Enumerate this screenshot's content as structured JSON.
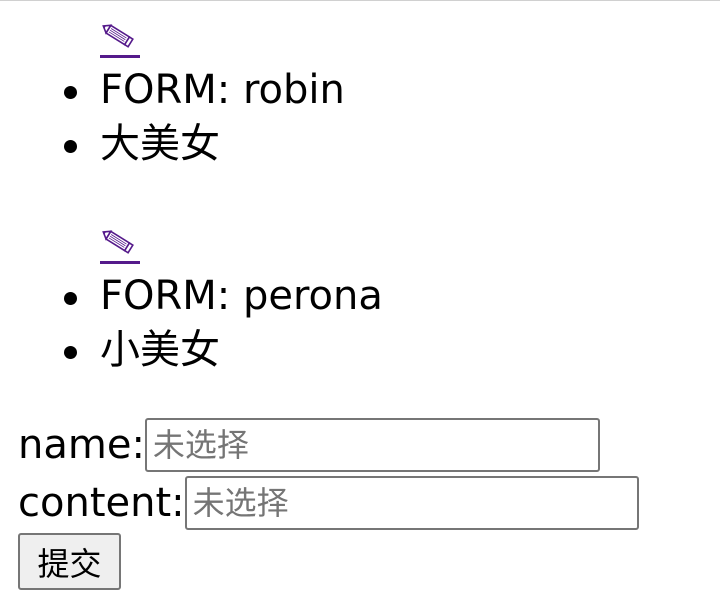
{
  "entries": [
    {
      "edit_icon": "pencil-icon",
      "form_line": "FORM: robin",
      "content_line": "大美女"
    },
    {
      "edit_icon": "pencil-icon",
      "form_line": "FORM: perona",
      "content_line": "小美女"
    }
  ],
  "form": {
    "name_label": "name:",
    "name_placeholder": "未选择",
    "content_label": "content:",
    "content_placeholder": "未选择",
    "submit_label": "提交"
  },
  "colors": {
    "link_visited": "#551a8b",
    "input_border": "#767676",
    "button_bg": "#efefef",
    "placeholder": "#757575"
  }
}
